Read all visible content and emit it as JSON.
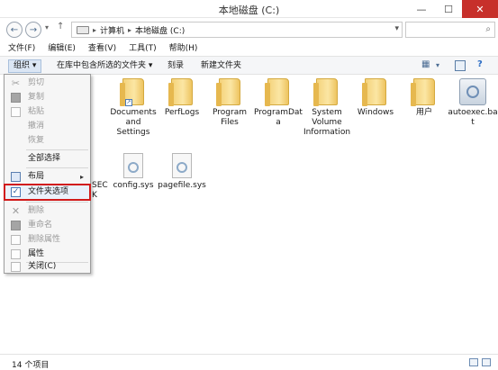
{
  "window": {
    "title": "本地磁盘 (C:)"
  },
  "window_controls": {
    "minimize": "—",
    "maximize": "☐",
    "close": "✕"
  },
  "address_bar": {
    "segments": [
      "计算机",
      "本地磁盘 (C:)"
    ]
  },
  "menubar": {
    "items": [
      "文件(F)",
      "编辑(E)",
      "查看(V)",
      "工具(T)",
      "帮助(H)"
    ]
  },
  "toolbar": {
    "organize": "组织 ▾",
    "include_library": "在库中包含所选的文件夹 ▾",
    "burn": "刻录",
    "new_folder": "新建文件夹"
  },
  "organize_menu": {
    "cut": "剪切",
    "copy": "复制",
    "paste": "粘贴",
    "undo": "撤消",
    "redo": "恢复",
    "select_all": "全部选择",
    "layout": "布局",
    "folder_options": "文件夹选项",
    "delete": "删除",
    "rename": "重命名",
    "remove_properties": "删除属性",
    "properties": "属性",
    "close": "关闭(C)"
  },
  "files": {
    "documents_settings": "Documents and Settings",
    "perflogs": "PerfLogs",
    "program_files": "Program Files",
    "program_data": "ProgramData",
    "system_volume": "System Volume Information",
    "windows": "Windows",
    "users": "用户",
    "autoexec": "autoexec.bat",
    "config": "config.sys",
    "pagefile": "pagefile.sys"
  },
  "partial_labels": {
    "row1": "t",
    "row2_a": "SEC",
    "row2_b": "K"
  },
  "status": {
    "item_count": "14 个项目"
  }
}
